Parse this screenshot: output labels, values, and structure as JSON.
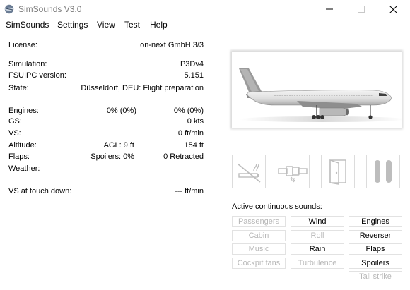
{
  "window": {
    "title": "SimSounds V3.0"
  },
  "menu": [
    "SimSounds",
    "Settings",
    "View",
    "Test",
    "Help"
  ],
  "info": {
    "license_label": "License:",
    "license_value": "on-next GmbH 3/3",
    "simulation_label": "Simulation:",
    "simulation_value": "P3Dv4",
    "fsuipc_label": "FSUIPC version:",
    "fsuipc_value": "5.151",
    "state_label": "State:",
    "state_value": "Düsseldorf, DEU:  Flight preparation",
    "engines_label": "Engines:",
    "engines_mid": "0% (0%)",
    "engines_value": "0% (0%)",
    "gs_label": "GS:",
    "gs_value": "0 kts",
    "vs_label": "VS:",
    "vs_value": "0 ft/min",
    "altitude_label": "Altitude:",
    "altitude_mid": "AGL: 9 ft",
    "altitude_value": "154 ft",
    "flaps_label": "Flaps:",
    "flaps_mid": "Spoilers: 0%",
    "flaps_value": "0 Retracted",
    "weather_label": "Weather:",
    "touchdown_label": "VS at touch down:",
    "touchdown_value": "--- ft/min"
  },
  "sounds": {
    "header": "Active continuous sounds:",
    "items": [
      {
        "label": "Passengers",
        "active": false
      },
      {
        "label": "Wind",
        "active": true
      },
      {
        "label": "Engines",
        "active": true
      },
      {
        "label": "Cabin",
        "active": false
      },
      {
        "label": "Roll",
        "active": false
      },
      {
        "label": "Reverser",
        "active": true
      },
      {
        "label": "Music",
        "active": false
      },
      {
        "label": "Rain",
        "active": true
      },
      {
        "label": "Flaps",
        "active": true
      },
      {
        "label": "Cockpit fans",
        "active": false
      },
      {
        "label": "Turbulence",
        "active": false
      },
      {
        "label": "Spoilers",
        "active": true
      },
      {
        "label": "Tail strike",
        "active": false
      }
    ]
  },
  "icons": [
    "no-smoking-icon",
    "seatbelt-icon",
    "door-icon",
    "pause-icon"
  ]
}
